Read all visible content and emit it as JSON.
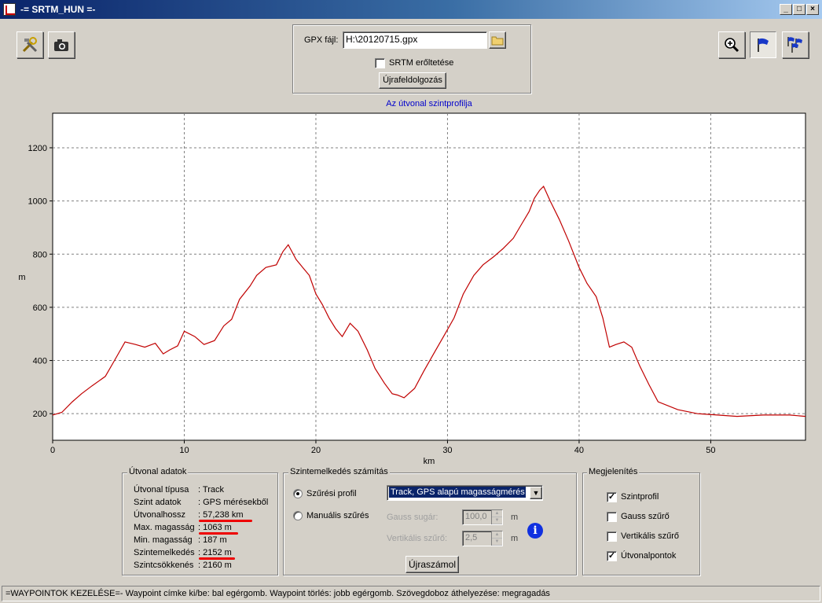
{
  "window": {
    "title": "-= SRTM_HUN =-"
  },
  "gpx": {
    "label": "GPX fájl:",
    "value": "H:\\20120715.gpx",
    "force_label": "SRTM erőltetése",
    "force_checked": false,
    "reprocess_label": "Újrafeldolgozás"
  },
  "chart_data": {
    "type": "line",
    "title": "Az útvonal szintprofilja",
    "xlabel": "km",
    "ylabel": "m",
    "xlim": [
      0,
      57.2
    ],
    "ylim": [
      100,
      1330
    ],
    "xticks": [
      0,
      10,
      20,
      30,
      40,
      50
    ],
    "yticks": [
      200,
      400,
      600,
      800,
      1000,
      1200
    ],
    "grid": true,
    "color": "#c00000",
    "series": [
      {
        "x": [
          0,
          0.7,
          1.5,
          2.2,
          3.0,
          4.0,
          4.7,
          5.5,
          6.3,
          7.0,
          7.8,
          8.4,
          8.9,
          9.5,
          10.0,
          10.8,
          11.5,
          12.3,
          13.0,
          13.6,
          14.2,
          15.0,
          15.5,
          16.2,
          17.0,
          17.5,
          17.9,
          18.5,
          19.0,
          19.5,
          20.0,
          20.5,
          21.0,
          21.5,
          22.0,
          22.6,
          23.2,
          23.9,
          24.5,
          25.2,
          25.8,
          26.2,
          26.7,
          27.5,
          28.2,
          29.0,
          29.7,
          30.5,
          31.2,
          32.0,
          32.7,
          33.5,
          34.2,
          35.0,
          35.6,
          36.2,
          36.6,
          37.0,
          37.3,
          37.8,
          38.5,
          39.2,
          40.0,
          40.6,
          41.3,
          41.8,
          42.3,
          42.8,
          43.4,
          44.0,
          44.6,
          45.3,
          46.0,
          47.5,
          49.0,
          50.5,
          52.0,
          54.0,
          56.0,
          57.2
        ],
        "y": [
          195,
          205,
          245,
          275,
          305,
          340,
          400,
          470,
          460,
          450,
          465,
          425,
          440,
          455,
          510,
          490,
          460,
          475,
          530,
          555,
          630,
          680,
          720,
          750,
          760,
          810,
          835,
          780,
          750,
          720,
          650,
          610,
          560,
          520,
          490,
          540,
          510,
          440,
          370,
          315,
          275,
          270,
          260,
          295,
          360,
          430,
          490,
          560,
          650,
          720,
          760,
          790,
          820,
          860,
          910,
          960,
          1010,
          1040,
          1055,
          1000,
          930,
          850,
          750,
          690,
          640,
          560,
          450,
          460,
          470,
          450,
          380,
          310,
          245,
          215,
          200,
          195,
          190,
          195,
          195,
          190
        ]
      }
    ]
  },
  "stats": {
    "title": "Útvonal adatok",
    "rows": [
      {
        "label": "Útvonal típusa",
        "value": ": Track"
      },
      {
        "label": "Szint adatok",
        "value": ": GPS mérésekből"
      },
      {
        "label": "Útvonalhossz",
        "value": ": 57,238 km"
      },
      {
        "label": "Max. magasság",
        "value": ": 1063 m"
      },
      {
        "label": "Min. magasság",
        "value": ": 187 m"
      },
      {
        "label": "Szintemelkedés",
        "value": ": 2152 m"
      },
      {
        "label": "Szintcsökkenés",
        "value": ": 2160 m"
      }
    ]
  },
  "calc": {
    "title": "Szintemelkedés számítás",
    "filter_profile_label": "Szűrési profil",
    "manual_label": "Manuális szűrés",
    "profile_value": "Track, GPS alapú magasságmérés",
    "gauss_label": "Gauss sugár:",
    "gauss_value": "100,0",
    "vertical_label": "Vertikális szűrő:",
    "vertical_value": "2,5",
    "unit": "m",
    "recalc_label": "Újraszámol"
  },
  "display": {
    "title": "Megjelenítés",
    "items": [
      {
        "label": "Szintprofil",
        "checked": true
      },
      {
        "label": "Gauss szűrő",
        "checked": false
      },
      {
        "label": "Vertikális szűrő",
        "checked": false
      },
      {
        "label": "Útvonalpontok",
        "checked": true
      }
    ]
  },
  "status": {
    "text": "=WAYPOINTOK KEZELÉSE=- Waypoint címke ki/be: bal egérgomb. Waypoint törlés: jobb egérgomb. Szövegdoboz áthelyezése: megragadás"
  },
  "colors": {
    "accent": "#0000cc",
    "line": "#c00000",
    "annotation": "#e00000"
  }
}
